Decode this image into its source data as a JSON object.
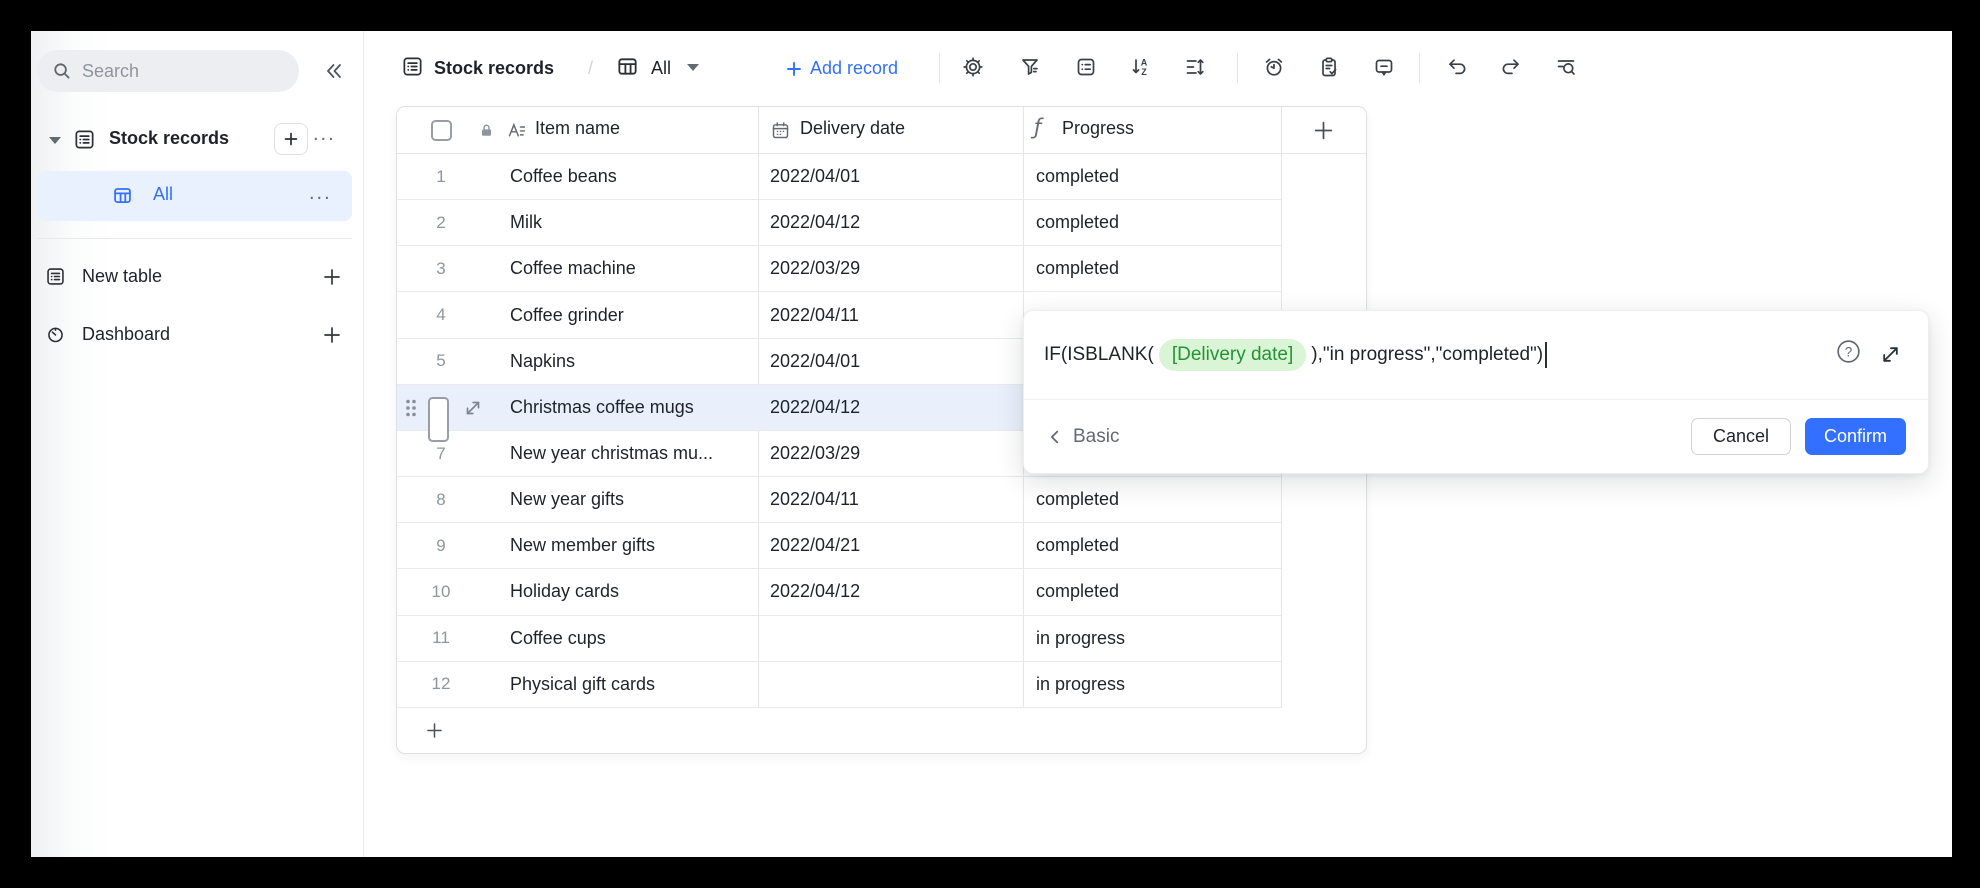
{
  "sidebar": {
    "search": {
      "placeholder": "Search",
      "icon": "search-icon"
    },
    "collapse_icon": "chevron-double-left-icon",
    "table_group": {
      "label": "Stock records",
      "expander_icon": "triangle-down-icon",
      "icon": "table-icon",
      "add_button_icon": "plus-icon",
      "more_label": "...",
      "more_icon": "ellipsis-icon"
    },
    "active_view": {
      "label": "All",
      "icon": "grid-view-icon",
      "more_label": "...",
      "more_icon": "ellipsis-icon"
    },
    "items": [
      {
        "label": "New table",
        "icon": "table-icon",
        "action_icon": "plus-icon"
      },
      {
        "label": "Dashboard",
        "icon": "dashboard-icon",
        "action_icon": "plus-icon"
      }
    ]
  },
  "header": {
    "breadcrumb": {
      "table": "Stock records",
      "separator": "/",
      "view": "All"
    },
    "add_record_label": "Add record",
    "toolbar_icons": [
      "settings-gear",
      "filter",
      "group-list",
      "sort-az",
      "row-height",
      "alarm-clock",
      "form-clipboard",
      "comment-bubble",
      "undo",
      "redo",
      "find-in-view"
    ]
  },
  "grid": {
    "columns": [
      {
        "label": "Item name",
        "type_icon": "text-type-icon",
        "lock_icon": "lock-icon"
      },
      {
        "label": "Delivery date",
        "type_icon": "calendar-icon"
      },
      {
        "label": "Progress",
        "type_icon": "formula-icon",
        "type_glyph": "ƒ"
      }
    ],
    "add_column_icon": "plus-icon",
    "add_row_icon": "plus-icon",
    "rows": [
      {
        "num": "1",
        "item": "Coffee beans",
        "date": "2022/04/01",
        "progress": "completed"
      },
      {
        "num": "2",
        "item": "Milk",
        "date": "2022/04/12",
        "progress": "completed"
      },
      {
        "num": "3",
        "item": "Coffee machine",
        "date": "2022/03/29",
        "progress": "completed"
      },
      {
        "num": "4",
        "item": "Coffee grinder",
        "date": "2022/04/11",
        "progress": ""
      },
      {
        "num": "5",
        "item": "Napkins",
        "date": "2022/04/01",
        "progress": ""
      },
      {
        "num": "",
        "item": "Christmas coffee mugs",
        "date": "2022/04/12",
        "progress": "",
        "selected": true
      },
      {
        "num": "7",
        "item": "New year christmas mu...",
        "date": "2022/03/29",
        "progress": ""
      },
      {
        "num": "8",
        "item": "New year gifts",
        "date": "2022/04/11",
        "progress": "completed"
      },
      {
        "num": "9",
        "item": "New member gifts",
        "date": "2022/04/21",
        "progress": "completed"
      },
      {
        "num": "10",
        "item": "Holiday cards",
        "date": "2022/04/12",
        "progress": "completed"
      },
      {
        "num": "11",
        "item": "Coffee cups",
        "date": "",
        "progress": "in progress"
      },
      {
        "num": "12",
        "item": "Physical gift cards",
        "date": "",
        "progress": "in progress"
      }
    ]
  },
  "formula_editor": {
    "prefix": "IF(ISBLANK(",
    "field_token": "[Delivery date]",
    "suffix": "),\"in progress\",\"completed\")",
    "help_icon": "help-circle-icon",
    "expand_icon": "expand-icon",
    "back": {
      "icon": "chevron-left-icon",
      "label": "Basic"
    },
    "cancel_label": "Cancel",
    "confirm_label": "Confirm"
  },
  "colors": {
    "accent": "#3370ff",
    "selected_row_bg": "#e9f0fc",
    "token_bg": "#d9f5d5",
    "token_text": "#249334",
    "border": "#dee0e3",
    "text_primary": "#1f2329",
    "text_secondary": "#8f959e"
  }
}
